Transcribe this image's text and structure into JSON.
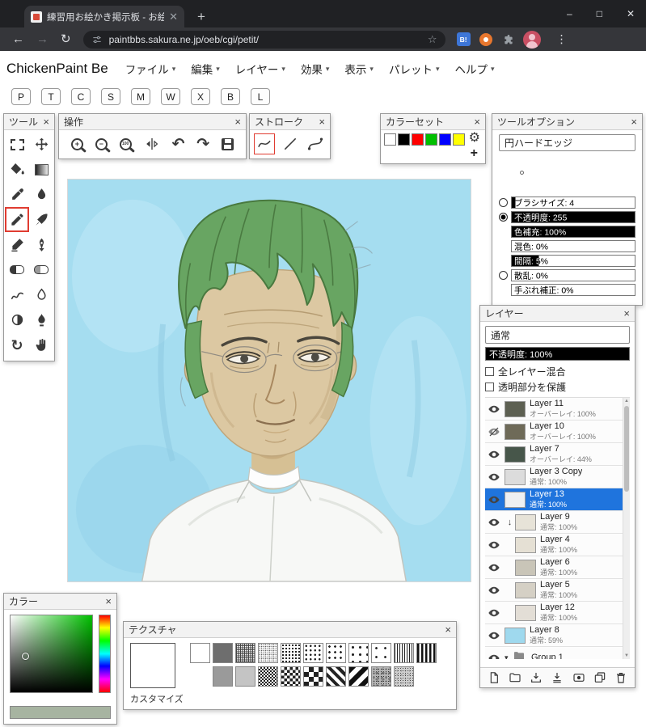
{
  "browser": {
    "tab_title": "練習用お絵かき掲示板 - お絵かき",
    "url": "paintbbs.sakura.ne.jp/oeb/cgi/petit/",
    "extension_badge": "B!"
  },
  "menubar": {
    "app_title": "ChickenPaint Be",
    "menus": [
      "ファイル",
      "編集",
      "レイヤー",
      "効果",
      "表示",
      "パレット",
      "ヘルプ"
    ]
  },
  "shortcut_buttons": [
    "P",
    "T",
    "C",
    "S",
    "M",
    "W",
    "X",
    "B",
    "L"
  ],
  "tools_palette": {
    "title": "ツール",
    "tools": [
      {
        "name": "rect-select"
      },
      {
        "name": "move"
      },
      {
        "name": "flood-fill"
      },
      {
        "name": "gradient"
      },
      {
        "name": "eyedropper"
      },
      {
        "name": "water"
      },
      {
        "name": "pencil",
        "selected": true
      },
      {
        "name": "pen"
      },
      {
        "name": "airbrush"
      },
      {
        "name": "pen-nib"
      },
      {
        "name": "eraser"
      },
      {
        "name": "soft-eraser"
      },
      {
        "name": "smudge"
      },
      {
        "name": "blur"
      },
      {
        "name": "dodge"
      },
      {
        "name": "burn"
      },
      {
        "name": "rotate"
      },
      {
        "name": "hand"
      }
    ]
  },
  "operations_palette": {
    "title": "操作",
    "buttons": [
      "zoom-in",
      "zoom-out",
      "zoom-100",
      "flip-horizontal",
      "undo",
      "redo",
      "save"
    ]
  },
  "stroke_palette": {
    "title": "ストローク",
    "modes": [
      {
        "name": "freehand",
        "selected": true
      },
      {
        "name": "line"
      },
      {
        "name": "bezier"
      }
    ]
  },
  "colorset_palette": {
    "title": "カラーセット",
    "swatches": [
      "#ffffff",
      "#000000",
      "#ff0000",
      "#00c000",
      "#0000ff",
      "#ffff00"
    ],
    "add_label": "+"
  },
  "tool_options_palette": {
    "title": "ツールオプション",
    "brush_type": "円ハードエッジ",
    "sliders": [
      {
        "id": "brush-size",
        "label": "ブラシサイズ: 4",
        "fill": 3,
        "radio": "off"
      },
      {
        "id": "opacity",
        "label": "不透明度: 255",
        "fill": 100,
        "radio": "on"
      },
      {
        "id": "color-recharge",
        "label": "色補充: 100%",
        "fill": 100
      },
      {
        "id": "blend",
        "label": "混色: 0%",
        "fill": 0
      },
      {
        "id": "spacing",
        "label": "間隔: 5%",
        "fill": 22
      },
      {
        "id": "scatter",
        "label": "散乱: 0%",
        "fill": 0,
        "radio": "off"
      },
      {
        "id": "stabilizer",
        "label": "手ぶれ補正: 0%",
        "fill": 0
      }
    ]
  },
  "layers_palette": {
    "title": "レイヤー",
    "blend_mode": "通常",
    "opacity_label": "不透明度: 100%",
    "options": [
      "全レイヤー混合",
      "透明部分を保護"
    ],
    "layers": [
      {
        "name": "Layer 11",
        "info": "オーバーレイ: 100%",
        "visible": true,
        "thumb": "#5d6052"
      },
      {
        "name": "Layer 10",
        "info": "オーバーレイ: 100%",
        "visible": false,
        "thumb": "#6e6a58"
      },
      {
        "name": "Layer 7",
        "info": "オーバーレイ: 44%",
        "visible": true,
        "thumb": "#47564a"
      },
      {
        "name": "Layer 3 Copy",
        "info": "通常: 100%",
        "visible": true,
        "thumb": "#dcdcdc"
      },
      {
        "name": "Layer 13",
        "info": "通常: 100%",
        "visible": true,
        "selected": true,
        "thumb": "#eef0f2"
      },
      {
        "name": "Layer 9",
        "info": "通常: 100%",
        "visible": true,
        "clipped": true,
        "thumb": "#e7e3d8"
      },
      {
        "name": "Layer 4",
        "info": "通常: 100%",
        "visible": true,
        "indent": true,
        "thumb": "#e5e0d4"
      },
      {
        "name": "Layer 6",
        "info": "通常: 100%",
        "visible": true,
        "indent": true,
        "thumb": "#c9c5b8"
      },
      {
        "name": "Layer 5",
        "info": "通常: 100%",
        "visible": true,
        "indent": true,
        "thumb": "#d5d0c5"
      },
      {
        "name": "Layer 12",
        "info": "通常: 100%",
        "visible": true,
        "indent": true,
        "thumb": "#e3ded6"
      },
      {
        "name": "Layer 8",
        "info": "通常: 59%",
        "visible": true,
        "thumb": "#9fd9ee"
      },
      {
        "name": "Group 1",
        "info": "",
        "visible": true,
        "group": true
      }
    ],
    "toolbar": [
      "add-layer",
      "add-group",
      "import-image",
      "merge-down",
      "layer-mask",
      "duplicate-layer",
      "delete-layer"
    ]
  },
  "color_palette": {
    "title": "カラー",
    "hue": "#00c000",
    "current_color": "#a7b4a1"
  },
  "texture_palette": {
    "title": "テクスチャ",
    "customize_label": "カスタマイズ",
    "row1": [
      "white",
      "dark",
      "grid-fine",
      "dots-fine",
      "halftone-dense",
      "halftone",
      "dots-sparse",
      "dots-sparser",
      "dots-tiny",
      "vlines",
      "vlines-bold"
    ],
    "row2": [
      "gray",
      "gray-light",
      "checker-fine",
      "checker",
      "checker-bold",
      "diag-checker",
      "diag-half",
      "noise",
      "noise-fine"
    ]
  }
}
